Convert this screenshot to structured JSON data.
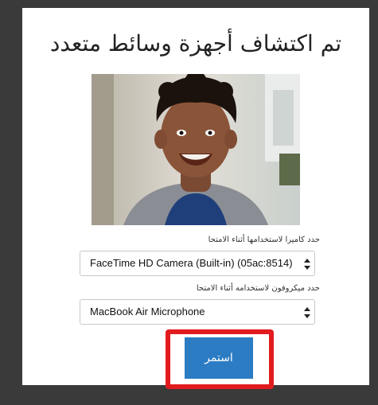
{
  "dialog": {
    "title": "تم اكتشاف أجهزة وسائط متعدد",
    "camera": {
      "label": "حدد كاميرا لاستخدامها أثناء الامتحا",
      "selected": "FaceTime HD Camera (Built-in) (05ac:8514)"
    },
    "microphone": {
      "label": "حدد ميكروفون لاستخدامه أثناء الامتحا",
      "selected": "MacBook Air Microphone"
    },
    "continue_label": "استمر"
  },
  "colors": {
    "button": "#2b7cc3",
    "highlight": "#e21b1f",
    "frame": "#3a3a3a"
  }
}
